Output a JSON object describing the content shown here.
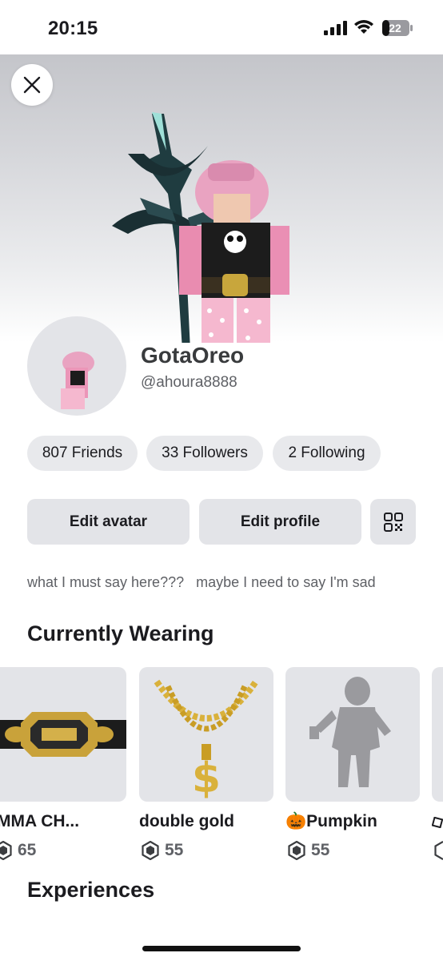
{
  "status_bar": {
    "time": "20:15",
    "battery": "22"
  },
  "profile": {
    "display_name": "GotaOreo",
    "username": "@ahoura8888",
    "bio": "what I must say here???   maybe I need to say I'm sad"
  },
  "stats": {
    "friends": "807 Friends",
    "followers": "33 Followers",
    "following": "2 Following"
  },
  "actions": {
    "edit_avatar": "Edit avatar",
    "edit_profile": "Edit profile"
  },
  "sections": {
    "currently_wearing": "Currently Wearing",
    "experiences": "Experiences"
  },
  "wearing": [
    {
      "name": "MMA CH...",
      "price": "65"
    },
    {
      "name": "double gold",
      "price": "55"
    },
    {
      "name": "🎃Pumpkin",
      "price": "55"
    }
  ],
  "colors": {
    "pill_bg": "#e8e9ec",
    "button_bg": "#e3e4e8",
    "text": "#1b1b1f",
    "muted": "#5f6166"
  }
}
